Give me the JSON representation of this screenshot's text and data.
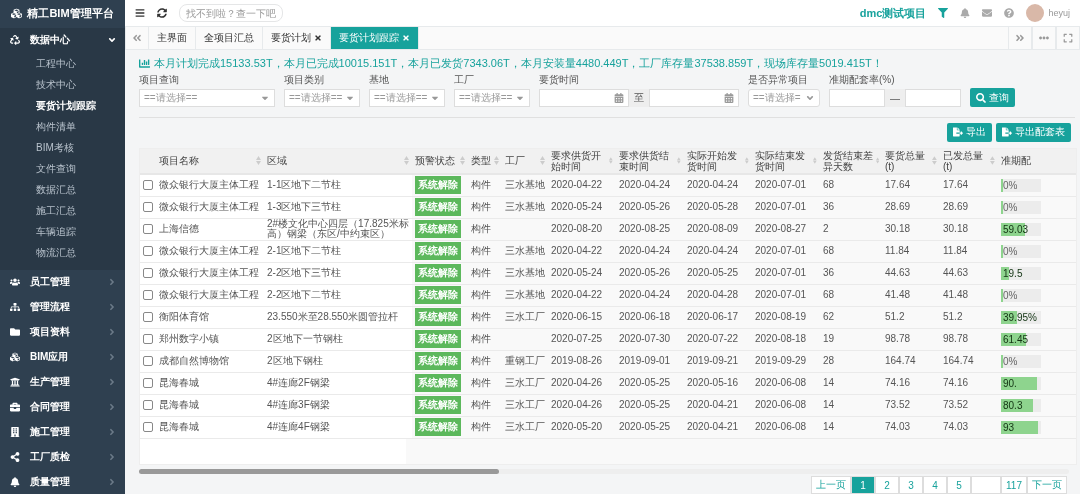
{
  "sidebar": {
    "logo": "精工BIM管理平台",
    "groups": [
      {
        "label": "数据中心",
        "expanded": true,
        "children": [
          {
            "label": "工程中心",
            "selected": false
          },
          {
            "label": "技术中心",
            "selected": false
          },
          {
            "label": "要货计划跟踪",
            "selected": true
          },
          {
            "label": "构件清单",
            "selected": false
          },
          {
            "label": "BIM考核",
            "selected": false
          },
          {
            "label": "文件查询",
            "selected": false
          },
          {
            "label": "数据汇总",
            "selected": false
          },
          {
            "label": "施工汇总",
            "selected": false
          },
          {
            "label": "车辆追踪",
            "selected": false
          },
          {
            "label": "物流汇总",
            "selected": false
          }
        ]
      },
      {
        "label": "员工管理",
        "expanded": false
      },
      {
        "label": "管理流程",
        "expanded": false
      },
      {
        "label": "项目资料",
        "expanded": false
      },
      {
        "label": "BIM应用",
        "expanded": false
      },
      {
        "label": "生产管理",
        "expanded": false
      },
      {
        "label": "合同管理",
        "expanded": false
      },
      {
        "label": "施工管理",
        "expanded": false
      },
      {
        "label": "工厂质检",
        "expanded": false
      },
      {
        "label": "质量管理",
        "expanded": false
      }
    ]
  },
  "topbar": {
    "search": {
      "placeholder": "找不到啦？查一下吧"
    },
    "project": "dmc测试项目",
    "user": "heyuj"
  },
  "tabs": [
    {
      "label": "主界面",
      "selected": false,
      "closable": false
    },
    {
      "label": "全项目汇总",
      "selected": false,
      "closable": false
    },
    {
      "label": "要货计划",
      "selected": false,
      "closable": true
    },
    {
      "label": "要货计划跟踪",
      "selected": true,
      "closable": true
    }
  ],
  "summary": "本月计划完成15133.53T，本月已完成10015.151T，本月已发货7343.06T，本月安装量4480.449T，工厂库存量37538.859T，现场库存量5019.415T！",
  "filters": [
    {
      "kind": "select",
      "label": "项目查询",
      "value": "==请选择=="
    },
    {
      "kind": "select",
      "label": "项目类别",
      "value": "==请选择=="
    },
    {
      "kind": "select",
      "label": "基地",
      "value": "==请选择=="
    },
    {
      "kind": "select",
      "label": "工厂",
      "value": "==请选择=="
    },
    {
      "kind": "daterange",
      "label": "要货时间",
      "separator": "至"
    },
    {
      "kind": "native",
      "label": "是否异常项目",
      "value": "==请选择="
    },
    {
      "kind": "range",
      "label": "准期配套率(%)",
      "separator": "—"
    }
  ],
  "search_button": "查询",
  "export_buttons": [
    "导出",
    "导出配套表"
  ],
  "table": {
    "columns": [
      "项目名称",
      "区域",
      "预警状态",
      "类型",
      "工厂",
      "要求供货开始时间",
      "要求供货结束时间",
      "实际开始发货时间",
      "实际结束发货时间",
      "发货结束差异天数",
      "要货总量(t)",
      "已发总量(t)",
      "准期配"
    ],
    "rows": [
      {
        "checked": false,
        "cells": [
          "微众银行大厦主体工程",
          "1-1区地下二节柱",
          "系统解除",
          "构件",
          "三水基地",
          "2020-04-22",
          "2020-04-24",
          "2020-04-24",
          "2020-07-01",
          "68",
          "17.64",
          "17.64"
        ],
        "level": 0,
        "reading": "0%"
      },
      {
        "checked": false,
        "cells": [
          "微众银行大厦主体工程",
          "1-3区地下三节柱",
          "系统解除",
          "构件",
          "三水基地",
          "2020-05-24",
          "2020-05-26",
          "2020-05-28",
          "2020-07-01",
          "36",
          "28.69",
          "28.69"
        ],
        "level": 0,
        "reading": "0%"
      },
      {
        "checked": false,
        "cells": [
          "上海信德",
          "2#楼文化中心四层（17.825米标高）钢梁（东区/中约束区）",
          "系统解除",
          "构件",
          null,
          "2020-08-20",
          "2020-08-25",
          "2020-08-09",
          "2020-08-27",
          "2",
          "30.18",
          "30.18"
        ],
        "level": 0.5903,
        "reading": "59.03"
      },
      {
        "checked": false,
        "cells": [
          "微众银行大厦主体工程",
          "2-1区地下二节柱",
          "系统解除",
          "构件",
          "三水基地",
          "2020-04-22",
          "2020-04-24",
          "2020-04-24",
          "2020-07-01",
          "68",
          "11.84",
          "11.84"
        ],
        "level": 0,
        "reading": "0%"
      },
      {
        "checked": false,
        "cells": [
          "微众银行大厦主体工程",
          "2-2区地下三节柱",
          "系统解除",
          "构件",
          "三水基地",
          "2020-05-24",
          "2020-05-26",
          "2020-05-25",
          "2020-07-01",
          "36",
          "44.63",
          "44.63"
        ],
        "level": 0.195,
        "reading": "19.5"
      },
      {
        "checked": false,
        "cells": [
          "微众银行大厦主体工程",
          "2-2区地下二节柱",
          "系统解除",
          "构件",
          "三水基地",
          "2020-04-22",
          "2020-04-24",
          "2020-04-28",
          "2020-07-01",
          "68",
          "41.48",
          "41.48"
        ],
        "level": 0,
        "reading": "0%"
      },
      {
        "checked": false,
        "cells": [
          "衡阳体育馆",
          "23.550米至28.550米圆管拉杆",
          "系统解除",
          "构件",
          "三水工厂",
          "2020-06-15",
          "2020-06-18",
          "2020-06-17",
          "2020-08-19",
          "62",
          "51.2",
          "51.2"
        ],
        "level": 0.3995,
        "reading": "39.95%"
      },
      {
        "checked": false,
        "cells": [
          "郑州数字小镇",
          "2区地下一节钢柱",
          "系统解除",
          "构件",
          null,
          "2020-07-25",
          "2020-07-30",
          "2020-07-22",
          "2020-08-18",
          "19",
          "98.78",
          "98.78"
        ],
        "level": 0.6145,
        "reading": "61.45"
      },
      {
        "checked": false,
        "cells": [
          "成都自然博物馆",
          "2区地下钢柱",
          "系统解除",
          "构件",
          "重钢工厂",
          "2019-08-26",
          "2019-09-01",
          "2019-09-21",
          "2019-09-29",
          "28",
          "164.74",
          "164.74"
        ],
        "level": 0,
        "reading": "0%"
      },
      {
        "checked": false,
        "cells": [
          "昆海春城",
          "4#连廊2F钢梁",
          "系统解除",
          "构件",
          "三水工厂",
          "2020-04-26",
          "2020-05-25",
          "2020-05-16",
          "2020-06-08",
          "14",
          "74.16",
          "74.16"
        ],
        "level": 0.9,
        "reading": "90."
      },
      {
        "checked": false,
        "cells": [
          "昆海春城",
          "4#连廊3F钢梁",
          "系统解除",
          "构件",
          "三水工厂",
          "2020-04-26",
          "2020-05-25",
          "2020-04-21",
          "2020-06-08",
          "14",
          "73.52",
          "73.52"
        ],
        "level": 0.8,
        "reading": "80.3"
      },
      {
        "checked": false,
        "cells": [
          "昆海春城",
          "4#连廊4F钢梁",
          "系统解除",
          "构件",
          "三水工厂",
          "2020-05-20",
          "2020-05-25",
          "2020-04-21",
          "2020-06-08",
          "14",
          "74.03",
          "74.03"
        ],
        "level": 0.93,
        "reading": "93"
      }
    ]
  },
  "pagination": {
    "prev": "上一页",
    "pages": [
      {
        "kind": "page",
        "label": "1",
        "selected": true
      },
      {
        "kind": "page",
        "label": "2",
        "selected": false
      },
      {
        "kind": "page",
        "label": "3",
        "selected": false
      },
      {
        "kind": "page",
        "label": "4",
        "selected": false
      },
      {
        "kind": "page",
        "label": "5",
        "selected": false
      },
      {
        "kind": "gap"
      },
      {
        "kind": "page",
        "label": "117",
        "selected": false
      }
    ],
    "next": "下一页"
  }
}
